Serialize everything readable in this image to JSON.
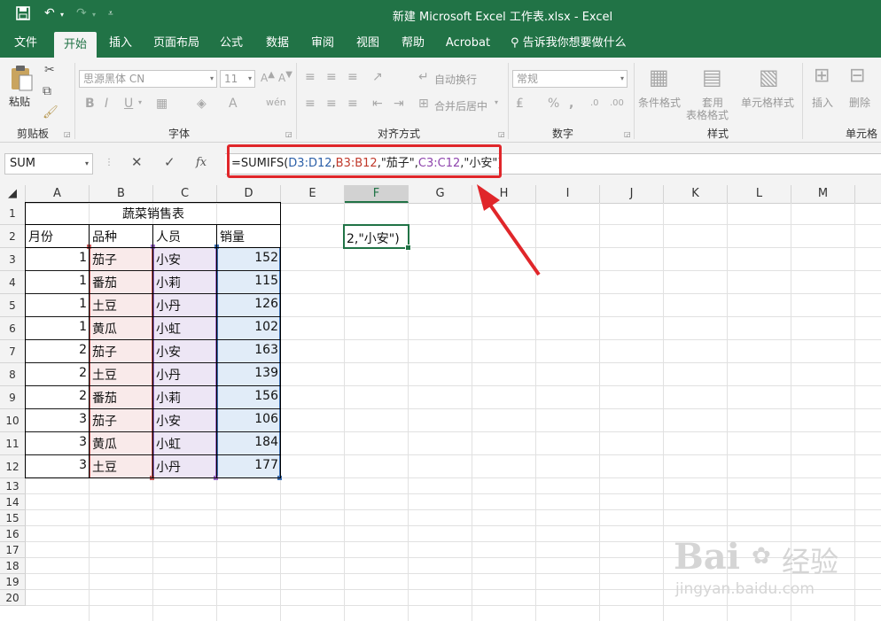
{
  "window": {
    "title": "新建 Microsoft Excel 工作表.xlsx  -  Excel"
  },
  "tabs": [
    "文件",
    "开始",
    "插入",
    "页面布局",
    "公式",
    "数据",
    "审阅",
    "视图",
    "帮助",
    "Acrobat"
  ],
  "tell_me": "告诉我你想要做什么",
  "ribbon": {
    "clipboard": {
      "label": "剪贴板",
      "paste": "粘贴"
    },
    "font": {
      "label": "字体",
      "font_name": "思源黑体 CN",
      "font_size": "11"
    },
    "alignment": {
      "label": "对齐方式",
      "wrap": "自动换行",
      "merge": "合并后居中"
    },
    "number": {
      "label": "数字",
      "format": "常规"
    },
    "styles": {
      "label": "样式",
      "cond": "条件格式",
      "table_fmt_1": "套用",
      "table_fmt_2": "表格格式",
      "cell_style": "单元格样式"
    },
    "cells": {
      "label": "单元格",
      "insert": "插入",
      "delete": "删除"
    }
  },
  "formula_bar": {
    "name_box": "SUM",
    "cancel": "✕",
    "enter": "✓",
    "fx": "fx",
    "formula": {
      "p0": "=SUMIFS(",
      "p1": "D3:D12",
      "p2": ",",
      "p3": "B3:B12",
      "p4": ",\"茄子\",",
      "p5": "C3:C12",
      "p6": ",\"小安\")"
    }
  },
  "grid": {
    "columns": [
      "A",
      "B",
      "C",
      "D",
      "E",
      "F",
      "G",
      "H",
      "I",
      "J",
      "K",
      "L",
      "M"
    ],
    "rows": [
      "1",
      "2",
      "3",
      "4",
      "5",
      "6",
      "7",
      "8",
      "9",
      "10",
      "11",
      "12",
      "13",
      "14",
      "15",
      "16",
      "17",
      "18",
      "19",
      "20"
    ],
    "table_title": "蔬菜销售表",
    "headers": [
      "月份",
      "品种",
      "人员",
      "销量"
    ],
    "records": [
      [
        "1",
        "茄子",
        "小安",
        "152"
      ],
      [
        "1",
        "番茄",
        "小莉",
        "115"
      ],
      [
        "1",
        "土豆",
        "小丹",
        "126"
      ],
      [
        "1",
        "黄瓜",
        "小虹",
        "102"
      ],
      [
        "2",
        "茄子",
        "小安",
        "163"
      ],
      [
        "2",
        "土豆",
        "小丹",
        "139"
      ],
      [
        "2",
        "番茄",
        "小莉",
        "156"
      ],
      [
        "3",
        "茄子",
        "小安",
        "106"
      ],
      [
        "3",
        "黄瓜",
        "小虹",
        "184"
      ],
      [
        "3",
        "土豆",
        "小丹",
        "177"
      ]
    ],
    "active_cell_text": "2,\"小安\")"
  },
  "watermark": {
    "brand": "Bai",
    "brand_cn": "经验",
    "url": "jingyan.baidu.com"
  },
  "colors": {
    "excel_green": "#217346",
    "annotation_red": "#e0262a"
  }
}
